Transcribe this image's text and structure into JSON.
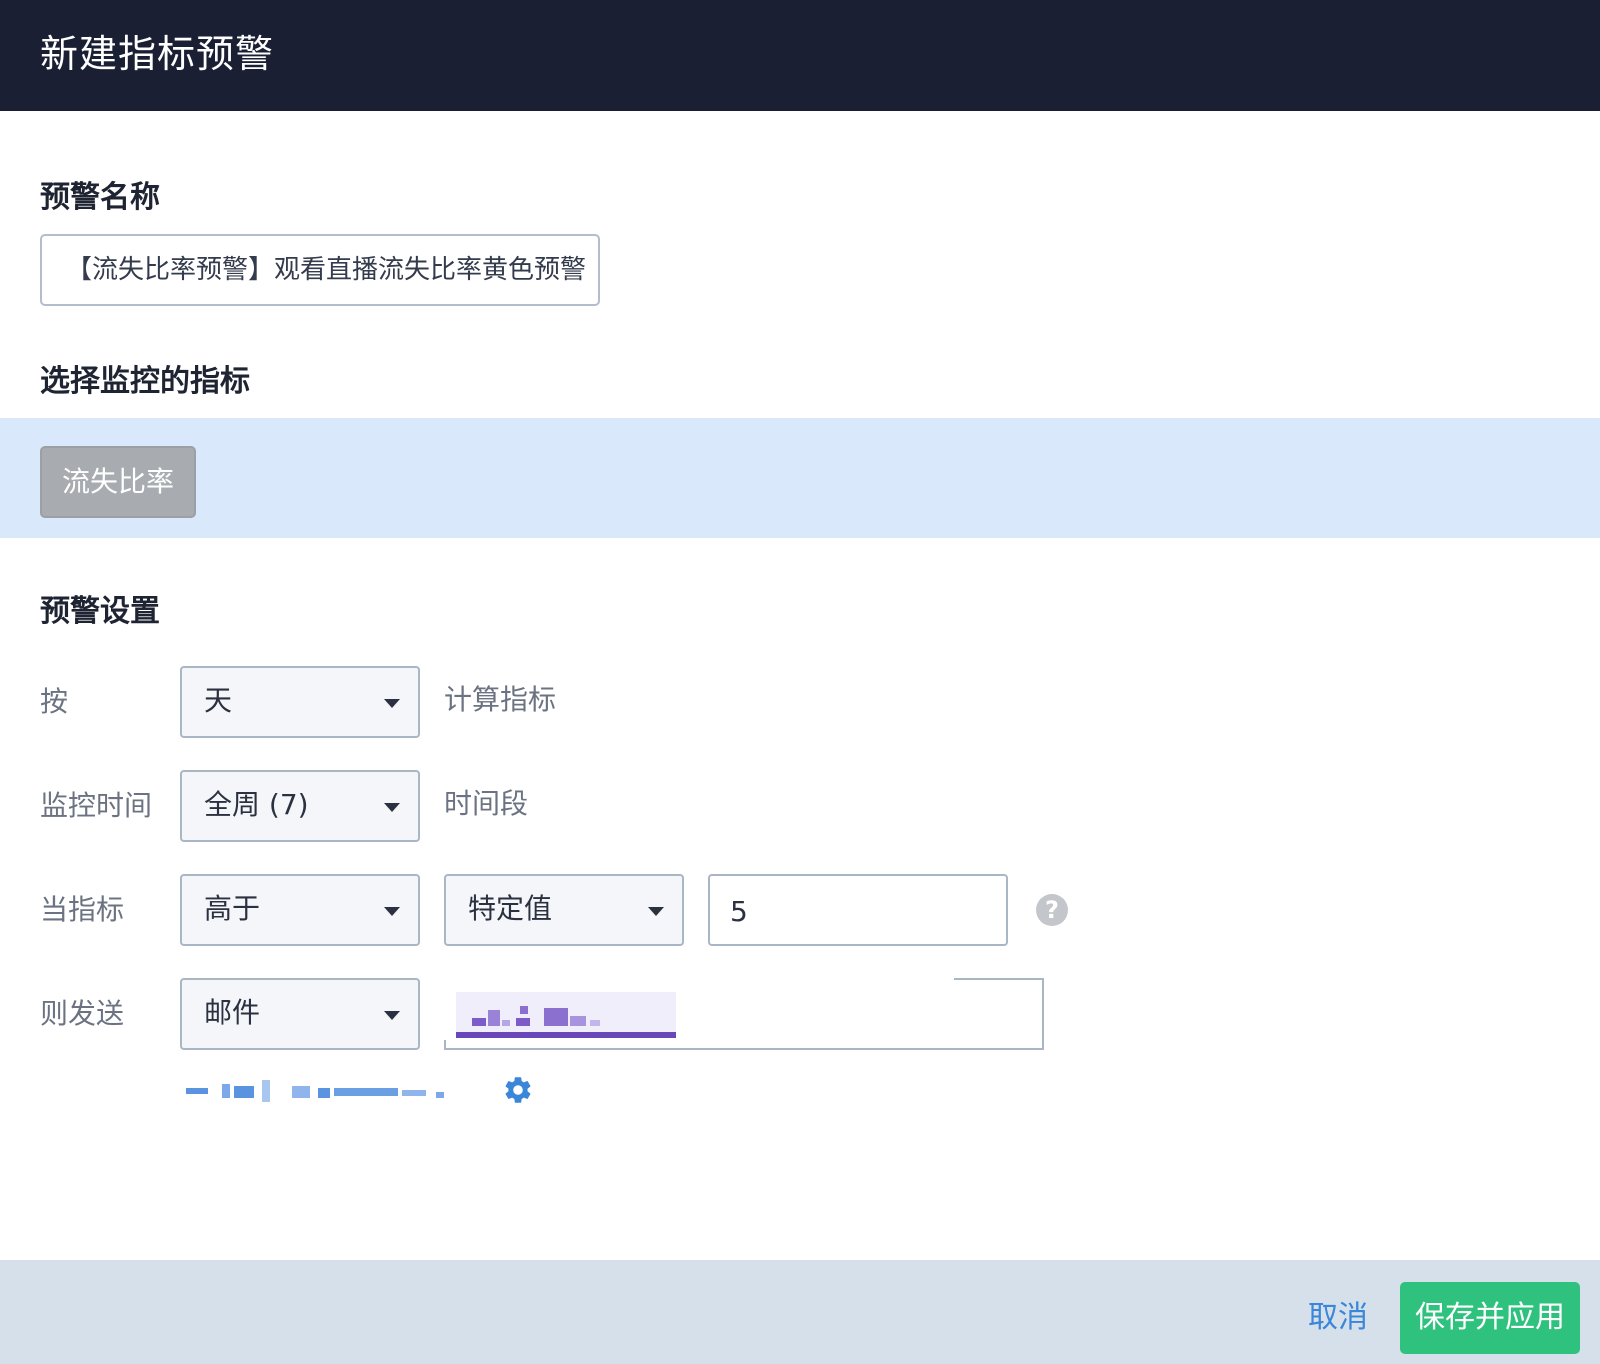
{
  "header": {
    "title": "新建指标预警"
  },
  "alert_name": {
    "label": "预警名称",
    "value": "【流失比率预警】观看直播流失比率黄色预警"
  },
  "metric": {
    "label": "选择监控的指标",
    "selected": "流失比率"
  },
  "settings": {
    "label": "预警设置",
    "by": {
      "label": "按",
      "value": "天",
      "suffix": "计算指标"
    },
    "monitor_time": {
      "label": "监控时间",
      "value": "全周 (7)",
      "suffix": "时间段"
    },
    "condition": {
      "label": "当指标",
      "comparator": "高于",
      "type": "特定值",
      "threshold": "5"
    },
    "send": {
      "label": "则发送",
      "channel": "邮件"
    }
  },
  "icons": {
    "help": "?",
    "gear": "gear-icon"
  },
  "footer": {
    "cancel": "取消",
    "save": "保存并应用"
  },
  "colors": {
    "header_bg": "#1a1f33",
    "metric_band": "#d9e9fb",
    "save_button": "#2ec27e",
    "cancel_link": "#3a86d8",
    "footer_bg": "#d6e0ea"
  }
}
